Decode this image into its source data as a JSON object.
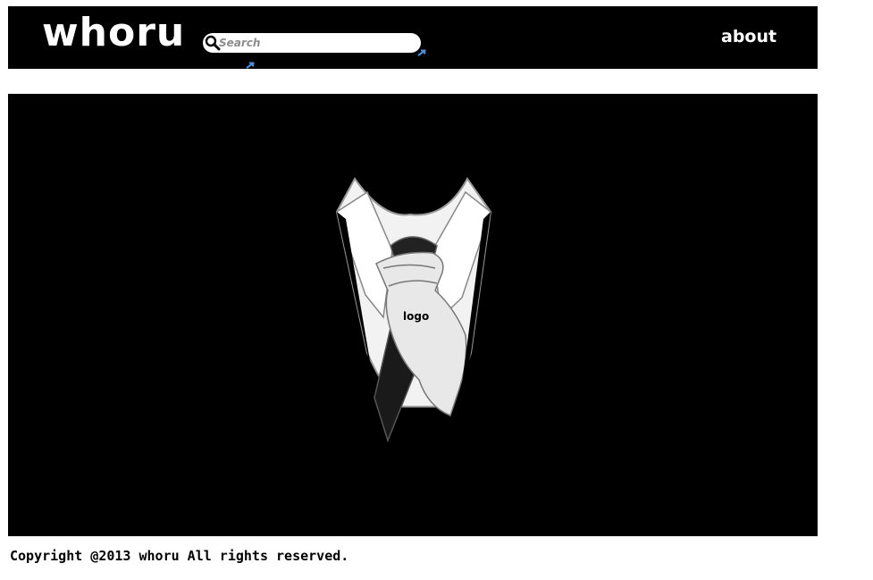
{
  "header": {
    "logo_text": "whoru",
    "search_placeholder": "Search",
    "about_label": "about"
  },
  "hero": {
    "logo_label": "logo"
  },
  "footer": {
    "copyright": "Copyright @2013 whoru All rights reserved."
  },
  "icons": {
    "search": "search-icon",
    "arrows": "arrow-icon"
  },
  "colors": {
    "header_bg": "#000000",
    "hero_bg": "#000000",
    "accent_arrow": "#4a90d9"
  }
}
